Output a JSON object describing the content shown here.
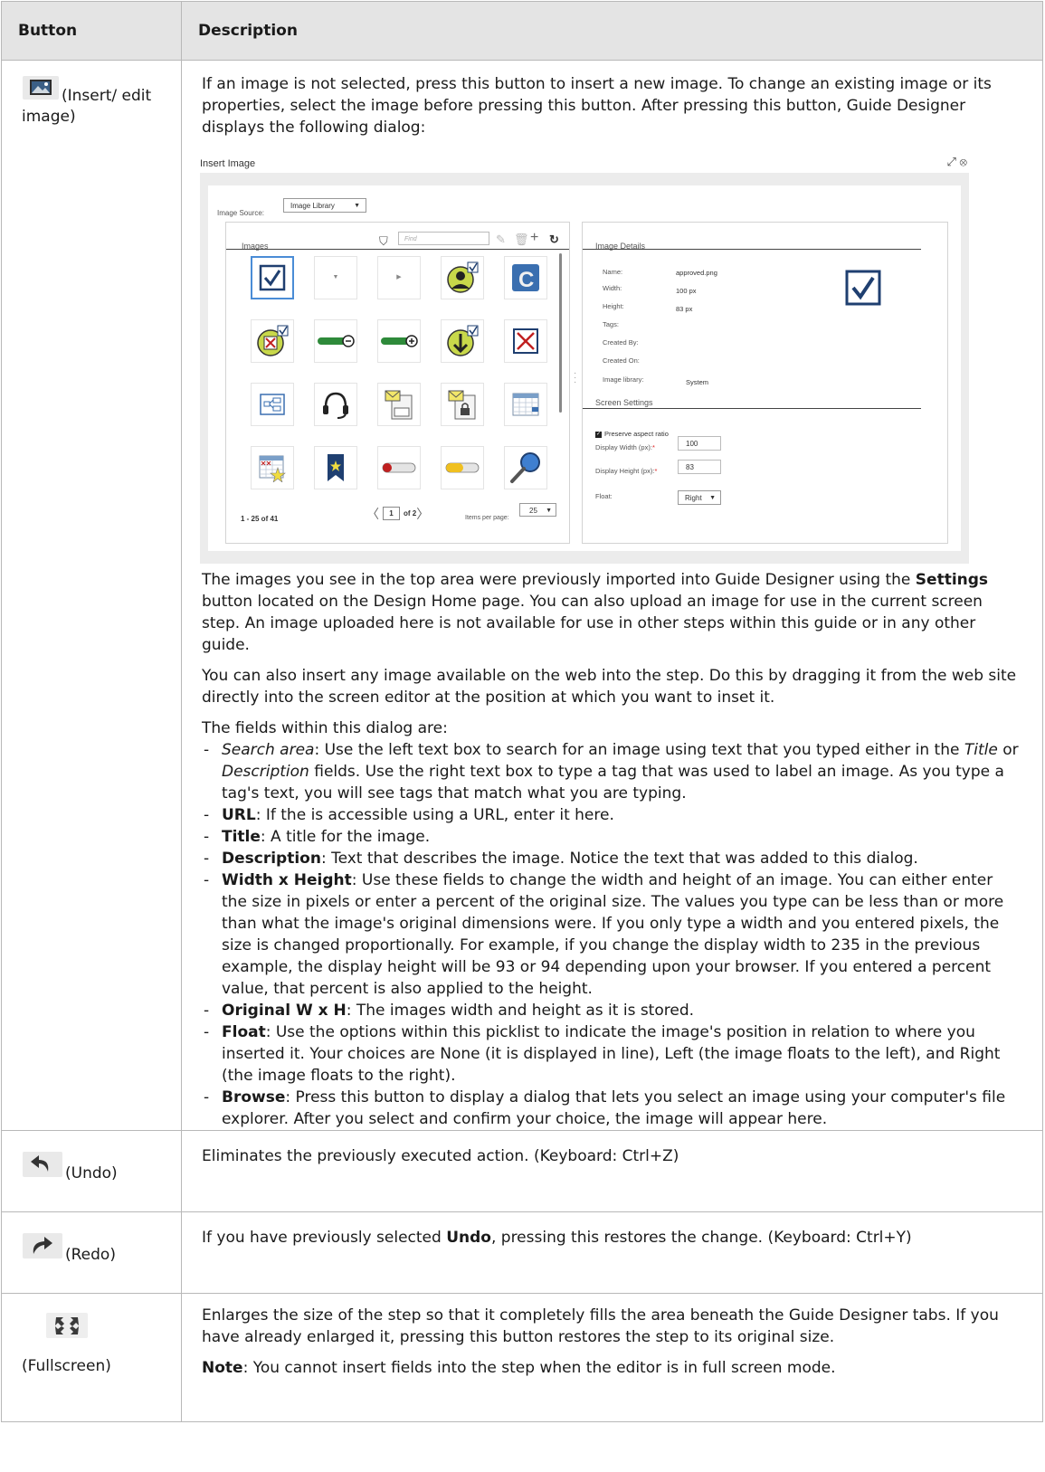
{
  "header": {
    "col1": "Button",
    "col2": "Description"
  },
  "rows": {
    "insert": {
      "label": "(Insert/ edit image)",
      "icon": "image-icon",
      "intro": "If an image is not selected, press this button to insert a new image. To change an existing image or its properties, select the image before pressing this button. After pressing this button, Guide Designer displays the following dialog:",
      "para1_a": "The images you see in the top area were previously imported into Guide Designer using the ",
      "para1_bold": "Settings",
      "para1_b": " button located on the Design Home page. You can also upload an image for use in the current screen step. An image uploaded here is not available for use in other steps within this guide or in any other guide.",
      "para2": "You can also insert any image available on the web into the step. Do this by dragging it from the web site directly into the screen editor at the position at which you want to inset it.",
      "fields_intro": "The fields within this dialog are:",
      "fields": [
        {
          "name": "Search area",
          "style": "italic",
          "t1": ": Use the left text box to search for an image using text that you typed either in the ",
          "i1": "Title",
          "t2": " or ",
          "i2": "Description",
          "t3": " fields. Use the right text box to type a tag that was used to label an image. As you type a tag's text, you will see tags that match what you are typing."
        },
        {
          "name": "URL",
          "style": "bold",
          "text": ": If the is accessible using a URL, enter it here."
        },
        {
          "name": "Title",
          "style": "bold",
          "text": ": A title for the image."
        },
        {
          "name": "Description",
          "style": "bold",
          "text": ": Text that describes the image. Notice the text that was added to this dialog."
        },
        {
          "name": "Width x Height",
          "style": "bold",
          "text": ": Use these fields to change the width and height of an image. You can either enter the size in pixels or enter a percent of the original size. The values you type can be less than or more than what the image's original dimensions were. If you only type a width and you entered pixels, the size is changed proportionally. For example, if you change the display width to 235 in the previous example, the display height will be 93 or 94 depending upon your browser. If you entered a percent value, that percent is also applied to the height."
        },
        {
          "name": "Original W x H",
          "style": "bold",
          "text": ": The images width and height as it is stored."
        },
        {
          "name": "Float",
          "style": "bold",
          "text": ": Use the options within this picklist to indicate the image's position in relation to where you inserted it. Your choices are None (it is displayed in line), Left (the image floats to the left), and Right (the image floats to the right)."
        },
        {
          "name": "Browse",
          "style": "bold",
          "text": ": Press this button to display a dialog that lets you select an image using your computer's file explorer. After you select and confirm your choice, the image will appear here."
        }
      ]
    },
    "undo": {
      "label": "(Undo)",
      "icon": "undo-icon",
      "desc": "Eliminates the previously executed action. (Keyboard: Ctrl+Z)"
    },
    "redo": {
      "label": "(Redo)",
      "icon": "redo-icon",
      "desc_a": "If you have previously selected ",
      "desc_bold": "Undo",
      "desc_b": ", pressing this restores the change. (Keyboard: Ctrl+Y)"
    },
    "fullscreen": {
      "label": "(Fullscreen)",
      "icon": "fullscreen-icon",
      "desc": "Enlarges the size of the step so that it completely fills the area beneath the Guide Designer tabs. If you have already enlarged it, pressing this button restores the step to its original size.",
      "note_bold": "Note",
      "note": ": You cannot insert fields into the step when the editor is in full screen mode."
    }
  },
  "dialog": {
    "title": "Insert Image",
    "image_source_label": "Image Source:",
    "image_source_value": "Image Library",
    "images_title": "Images",
    "find_placeholder": "Find",
    "tiles": [
      "checkbox-checked-icon",
      "dropdown-arrow-icon",
      "right-arrow-icon",
      "user-check-icon",
      "c-logo-icon",
      "reject-checked-icon",
      "progress-minus-icon",
      "progress-plus-icon",
      "download-check-icon",
      "x-box-icon",
      "flowchart-icon",
      "headset-icon",
      "mail-document-icon",
      "mail-lock-icon",
      "calendar-icon",
      "calendar-star-icon",
      "bookmark-star-icon",
      "progress-red-icon",
      "progress-yellow-icon",
      "magnifier-icon"
    ],
    "pager": {
      "range": "1 - 25  of  41",
      "page": "1",
      "of": "of  2",
      "ipp_label": "Items per page:",
      "ipp_value": "25"
    },
    "details_title": "Image Details",
    "details": [
      {
        "k": "Name:",
        "v": "approved.png"
      },
      {
        "k": "Width:",
        "v": "100 px"
      },
      {
        "k": "Height:",
        "v": "83 px"
      },
      {
        "k": "Tags:",
        "v": ""
      },
      {
        "k": "Created By:",
        "v": ""
      },
      {
        "k": "Created On:",
        "v": ""
      },
      {
        "k": "Image library:",
        "v": "System"
      }
    ],
    "screen_settings_title": "Screen Settings",
    "preserve_label": "Preserve aspect ratio",
    "display_width_label": "Display Width (px):",
    "display_width_value": "100",
    "display_height_label": "Display Height (px):",
    "display_height_value": "83",
    "float_label": "Float:",
    "float_value": "Right",
    "required_mark": "*"
  }
}
